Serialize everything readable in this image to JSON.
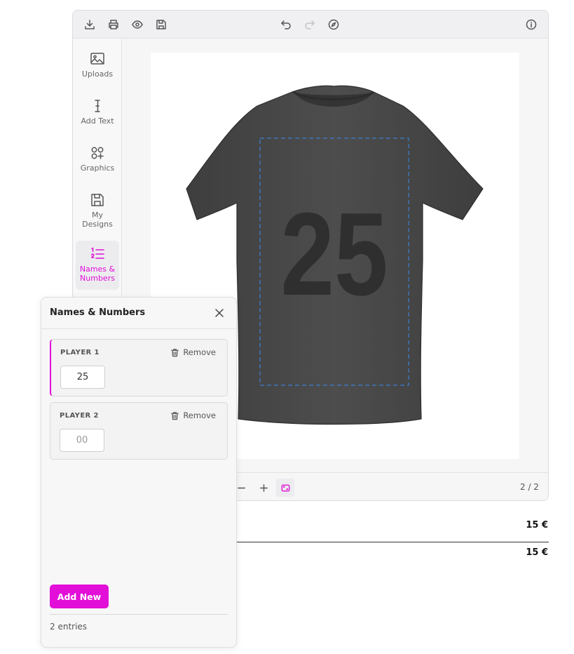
{
  "sidebar": {
    "items": [
      {
        "label": "Uploads",
        "icon": "image-icon"
      },
      {
        "label": "Add Text",
        "icon": "text-cursor-icon"
      },
      {
        "label": "Graphics",
        "icon": "shapes-icon"
      },
      {
        "label": "My Designs",
        "icon": "save-icon"
      },
      {
        "label": "Names & Numbers",
        "icon": "numbered-list-icon"
      }
    ]
  },
  "canvas": {
    "print_number": "25"
  },
  "bottom_bar": {
    "page_indicator": "2 / 2"
  },
  "prices": {
    "line_price": "15 €",
    "total_price": "15 €"
  },
  "names_numbers_panel": {
    "title": "Names & Numbers",
    "remove_label": "Remove",
    "players": [
      {
        "label": "PLAYER 1",
        "value": "25",
        "placeholder": ""
      },
      {
        "label": "PLAYER 2",
        "value": "",
        "placeholder": "00"
      }
    ],
    "add_button_label": "Add New",
    "entries_count": "2 entries"
  },
  "colors": {
    "accent": "#e20fd8",
    "shirt": "#4a4a4a"
  }
}
